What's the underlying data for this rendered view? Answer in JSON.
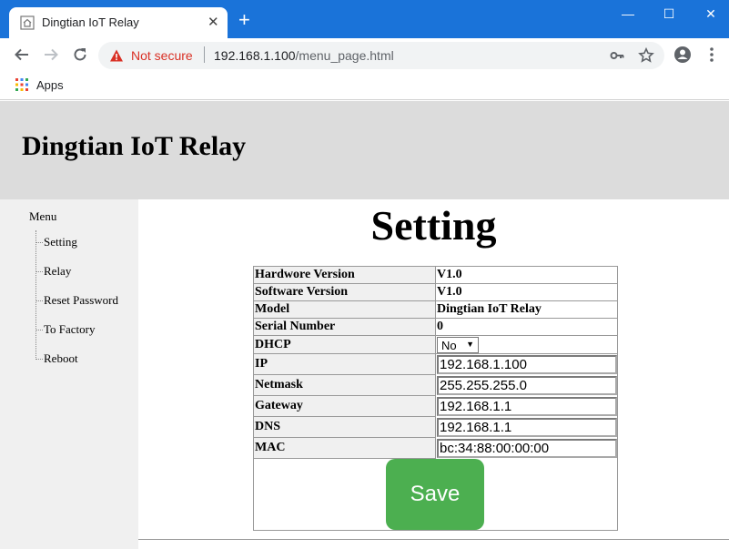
{
  "browser": {
    "tab_title": "Dingtian IoT Relay",
    "tab_close": "✕",
    "new_tab": "+",
    "security_label": "Not secure",
    "url_host": "192.168.1.100",
    "url_path": "/menu_page.html",
    "bookmarks": [
      {
        "label": "Apps"
      }
    ],
    "window_controls": {
      "minimize": "—",
      "maximize": "☐",
      "close": "✕"
    }
  },
  "header": {
    "site_title": "Dingtian IoT Relay"
  },
  "sidebar": {
    "menu_title": "Menu",
    "items": [
      {
        "label": "Setting"
      },
      {
        "label": "Relay"
      },
      {
        "label": "Reset Password"
      },
      {
        "label": "To Factory"
      },
      {
        "label": "Reboot"
      }
    ]
  },
  "main": {
    "heading": "Setting",
    "fields": {
      "hardware_version": {
        "label": "Hardwore Version",
        "value": "V1.0"
      },
      "software_version": {
        "label": "Software Version",
        "value": "V1.0"
      },
      "model": {
        "label": "Model",
        "value": "Dingtian IoT Relay"
      },
      "serial_number": {
        "label": "Serial Number",
        "value": "0"
      },
      "dhcp": {
        "label": "DHCP",
        "value": "No"
      },
      "ip": {
        "label": "IP",
        "value": "192.168.1.100"
      },
      "netmask": {
        "label": "Netmask",
        "value": "255.255.255.0"
      },
      "gateway": {
        "label": "Gateway",
        "value": "192.168.1.1"
      },
      "dns": {
        "label": "DNS",
        "value": "192.168.1.1"
      },
      "mac": {
        "label": "MAC",
        "value": "bc:34:88:00:00:00"
      }
    },
    "save_label": "Save"
  },
  "colors": {
    "chrome_blue": "#1a73d9",
    "header_bg": "#dcdcdc",
    "sidebar_bg": "#f0f0f0",
    "save_green": "#4caf50",
    "warning_red": "#d93025"
  }
}
